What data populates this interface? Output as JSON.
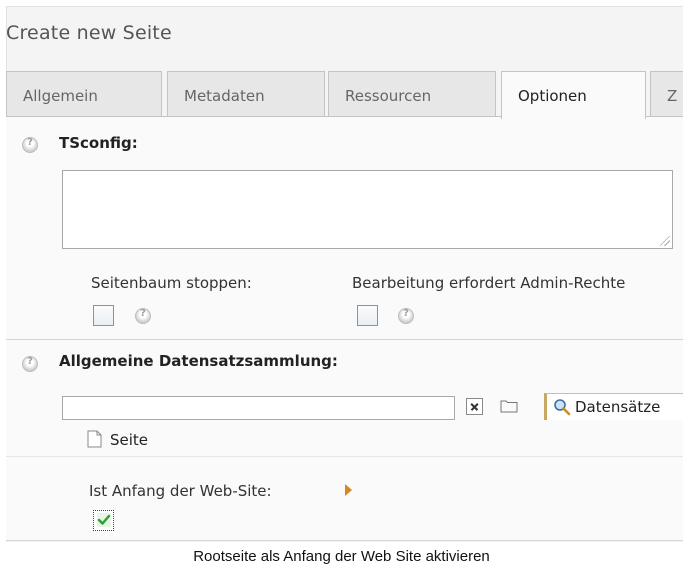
{
  "header": {
    "title": "Create new Seite"
  },
  "tabs": [
    {
      "label": "Allgemein"
    },
    {
      "label": "Metadaten"
    },
    {
      "label": "Ressourcen"
    },
    {
      "label": "Optionen",
      "active": true
    },
    {
      "label": "Z"
    }
  ],
  "tsconfig": {
    "label": "TSconfig:",
    "value": ""
  },
  "options": {
    "stop_tree_label": "Seitenbaum stoppen:",
    "stop_tree_checked": false,
    "admin_label": "Bearbeitung erfordert Admin-Rechte",
    "admin_checked": false
  },
  "storage": {
    "label": "Allgemeine Datensatzsammlung:",
    "value": "",
    "browse_label": "Datensätze",
    "type_label": "Seite"
  },
  "root": {
    "label": "Ist Anfang der Web-Site:",
    "checked": true
  },
  "caption": "Rootseite als Anfang der Web Site aktivieren",
  "colors": {
    "accent_arrow": "#d08a1e",
    "check_green": "#2e9e2e",
    "browse_border": "#c7a860"
  },
  "icons": [
    "help-icon",
    "resize-grip-icon",
    "clear-icon",
    "folder-icon",
    "search-icon",
    "page-icon",
    "arrow-right-icon",
    "checkmark-icon"
  ]
}
